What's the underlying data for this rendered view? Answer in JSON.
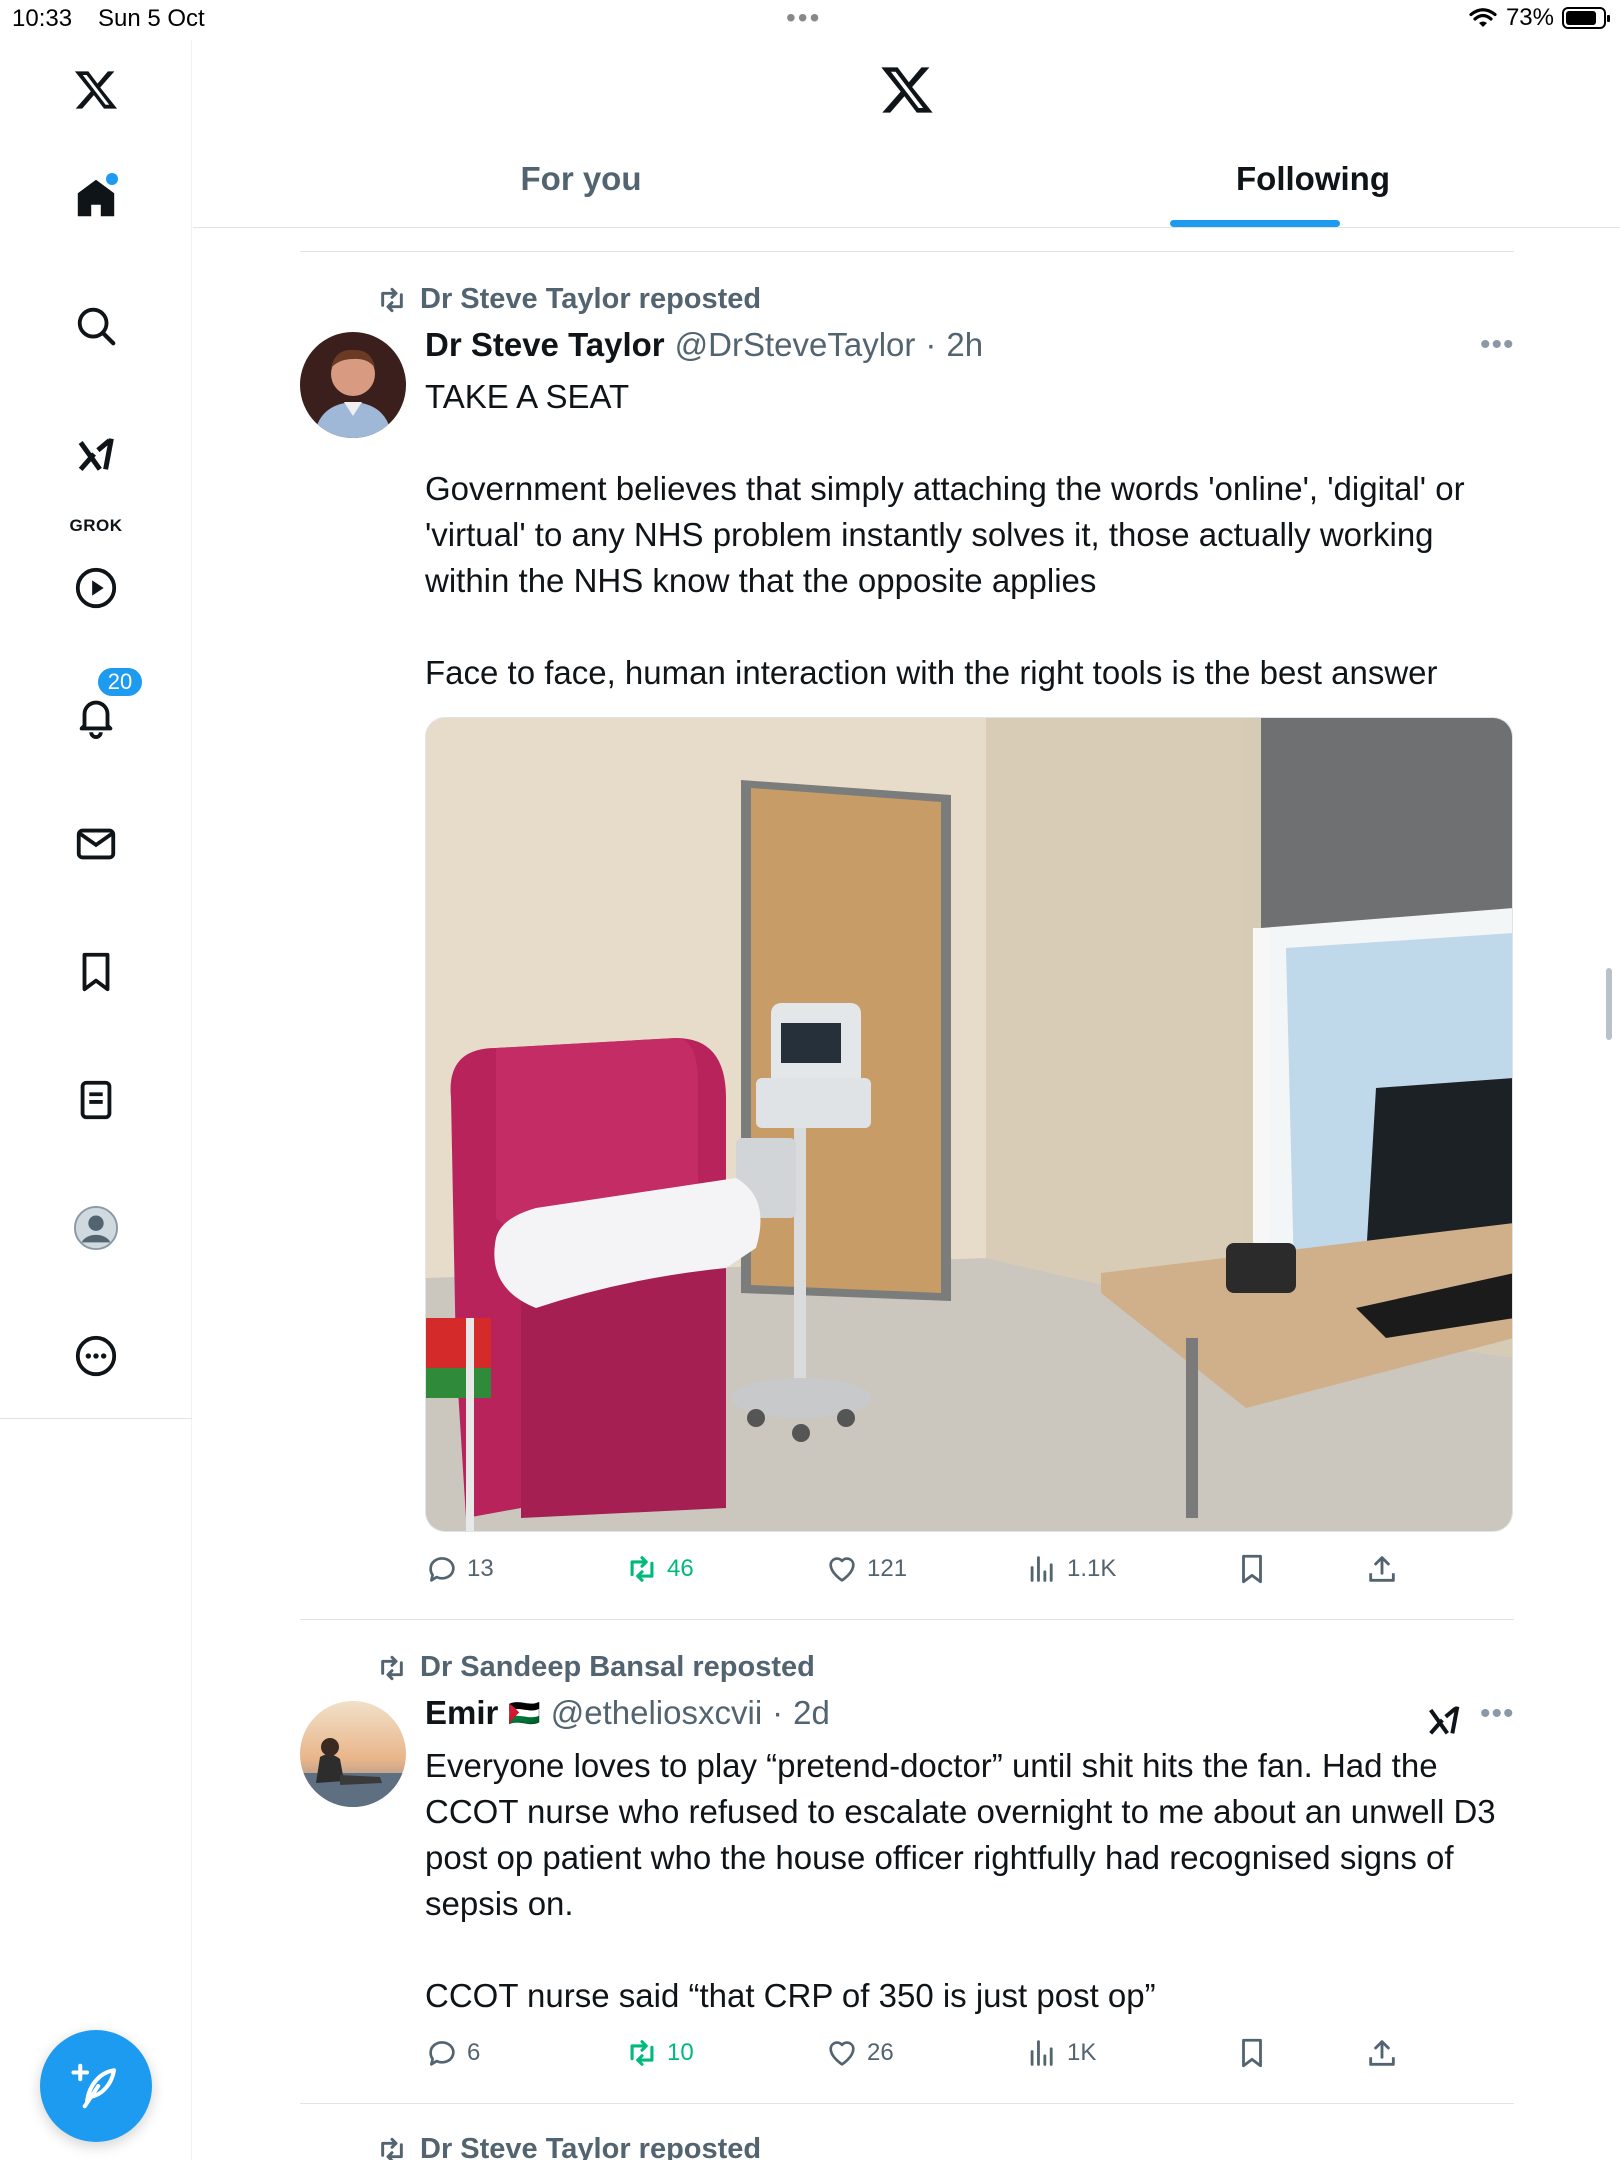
{
  "status_bar": {
    "time": "10:33",
    "date": "Sun 5 Oct",
    "battery": "73%",
    "battery_level": 0.73
  },
  "sidebar": {
    "notification_count": "20",
    "grok_label": "GROK",
    "items": [
      "x-logo",
      "home",
      "search",
      "grok",
      "video",
      "notifications",
      "messages",
      "bookmarks",
      "lists",
      "profile",
      "more"
    ]
  },
  "header": {
    "tabs": [
      {
        "label": "For you",
        "selected": false
      },
      {
        "label": "Following",
        "selected": true
      }
    ]
  },
  "colors": {
    "accent": "#1d9bf0",
    "repost_green": "#00ba7c",
    "secondary_text": "#536471",
    "chair": "#b8235c"
  },
  "tweets": [
    {
      "reposted_by": "Dr Steve Taylor reposted",
      "name": "Dr Steve Taylor",
      "handle": "@DrSteveTaylor",
      "sep": "·",
      "time": "2h",
      "text": "TAKE A SEAT\n\nGovernment believes that simply attaching the words 'online', 'digital' or 'virtual' to any NHS problem instantly solves it, those actually working within the NHS know that the opposite applies\n\nFace to face, human interaction with the right tools is the best answer",
      "replies": "13",
      "reposts": "46",
      "likes": "121",
      "views": "1.1K"
    },
    {
      "reposted_by": "Dr Sandeep Bansal reposted",
      "name": "Emir",
      "flag": "🇵🇸",
      "handle": "@etheliosxcvii",
      "sep": "·",
      "time": "2d",
      "text": "Everyone loves to play “pretend-doctor” until shit hits the fan. Had the CCOT nurse who refused to escalate overnight to me about an unwell D3 post op patient who the house officer rightfully had recognised signs of sepsis on.\n\nCCOT nurse said “that CRP of 350 is just post op”",
      "replies": "6",
      "reposts": "10",
      "likes": "26",
      "views": "1K"
    },
    {
      "reposted_by": "Dr Steve Taylor reposted"
    }
  ]
}
